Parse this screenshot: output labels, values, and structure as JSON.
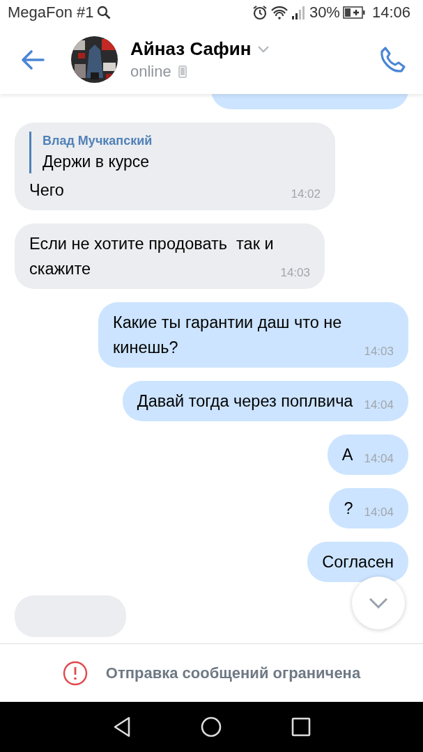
{
  "status_bar": {
    "carrier": "MegaFon #1",
    "battery": "30%",
    "time": "14:06"
  },
  "header": {
    "name": "Айназ Сафин",
    "status": "online"
  },
  "messages": [
    {
      "kind": "outgoing"
    },
    {
      "kind": "incoming",
      "reply": {
        "author": "Влад Мучкапский",
        "text": "Держи в курсе"
      },
      "text": "Чего",
      "time": "14:02"
    },
    {
      "kind": "incoming",
      "text": "Если не хотите продовать  так и скажите",
      "time": "14:03"
    },
    {
      "kind": "outgoing",
      "text": "Какие ты гарантии даш что не кинешь?",
      "time": "14:03"
    },
    {
      "kind": "outgoing",
      "text": "Давай тогда через поплвича",
      "time": "14:04"
    },
    {
      "kind": "outgoing",
      "text": "А",
      "time": "14:04"
    },
    {
      "kind": "outgoing",
      "text": "?",
      "time": "14:04"
    },
    {
      "kind": "outgoing",
      "text": "Согласен"
    },
    {
      "kind": "incoming"
    }
  ],
  "notice": "Отправка сообщений ограничена"
}
